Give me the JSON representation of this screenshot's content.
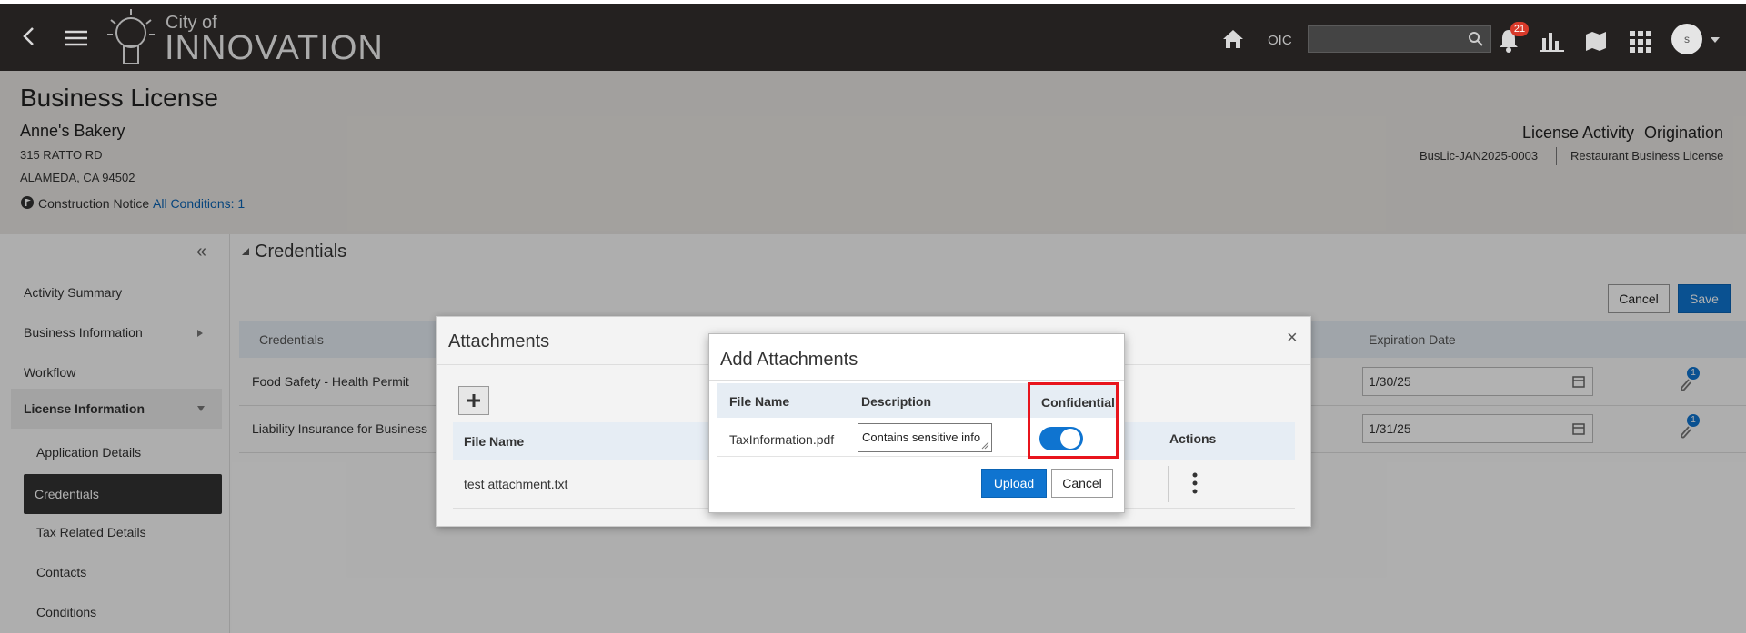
{
  "app": {
    "logo_small": "City of",
    "logo_big": "INNOVATION",
    "oic_label": "OIC",
    "notification_count": "21",
    "avatar_initial": "s"
  },
  "record": {
    "title": "Business License",
    "business_name": "Anne's Bakery",
    "address_line1": "315 RATTO RD",
    "address_line2": "ALAMEDA, CA 94502",
    "notice_label": "Construction Notice",
    "conditions_link": "All Conditions: 1",
    "activity_label": "License Activity",
    "activity_type": "Origination",
    "record_id": "BusLic-JAN2025-0003",
    "record_type": "Restaurant Business License"
  },
  "sidebar": {
    "items": [
      {
        "label": "Activity Summary"
      },
      {
        "label": "Business Information"
      },
      {
        "label": "Workflow"
      },
      {
        "label": "License Information"
      },
      {
        "label": "Application Details"
      },
      {
        "label": "Credentials"
      },
      {
        "label": "Tax Related Details"
      },
      {
        "label": "Contacts"
      },
      {
        "label": "Conditions"
      }
    ]
  },
  "main": {
    "section_title": "Credentials",
    "cancel_label": "Cancel",
    "save_label": "Save",
    "table": {
      "col_credentials": "Credentials",
      "col_expiration": "Expiration Date",
      "rows": [
        {
          "name": "Food Safety - Health Permit",
          "expiration": "1/30/25",
          "attachments": "1"
        },
        {
          "name": "Liability Insurance for Business",
          "expiration": "1/31/25",
          "attachments": "1"
        }
      ]
    }
  },
  "attachments_dialog": {
    "title": "Attachments",
    "close_glyph": "×",
    "col_file_name": "File Name",
    "col_actions": "Actions",
    "rows": [
      {
        "file_name": "test attachment.txt"
      }
    ]
  },
  "add_dialog": {
    "title": "Add Attachments",
    "col_file_name": "File Name",
    "col_description": "Description",
    "col_confidential": "Confidential",
    "file_name": "TaxInformation.pdf",
    "description": "Contains sensitive info",
    "confidential_on": true,
    "upload_label": "Upload",
    "cancel_label": "Cancel"
  },
  "colors": {
    "topbar": "#242120",
    "accent_blue": "#0f74d0",
    "highlight_red": "#e8141c"
  },
  "icons": [
    "back-icon",
    "menu-icon",
    "bulb-logo-icon",
    "home-icon",
    "search-icon",
    "bell-icon",
    "chart-icon",
    "map-icon",
    "grid-icon",
    "avatar",
    "chevron-down-icon",
    "flag-icon",
    "collapse-icon",
    "caret-icon",
    "calendar-icon",
    "paperclip-icon",
    "plus-icon",
    "close-icon",
    "kebab-icon"
  ]
}
